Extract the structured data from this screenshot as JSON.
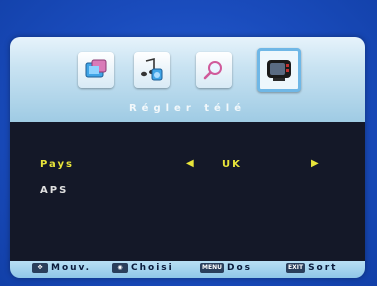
{
  "menu": {
    "section_title": "Régler télé",
    "tabs": [
      {
        "name": "picture-settings-tab",
        "icon": "picture-icon",
        "selected": false
      },
      {
        "name": "audio-settings-tab",
        "icon": "music-icon",
        "selected": false
      },
      {
        "name": "search-tab",
        "icon": "magnifier-icon",
        "selected": false
      },
      {
        "name": "tv-settings-tab",
        "icon": "tv-icon",
        "selected": true
      }
    ]
  },
  "settings": {
    "country_label": "Pays",
    "country_value": "UK",
    "aps_label": "APS"
  },
  "footer": {
    "move_label": "Mouv.",
    "select_label": "Choisi",
    "back_key": "MENU",
    "back_label": "Dos",
    "exit_key": "EXIT",
    "exit_label": "Sort"
  },
  "colors": {
    "highlight": "#e8e43a",
    "menu_background": "#141828",
    "outer_background": "#1747b5",
    "header_light": "#c9e3f2"
  }
}
